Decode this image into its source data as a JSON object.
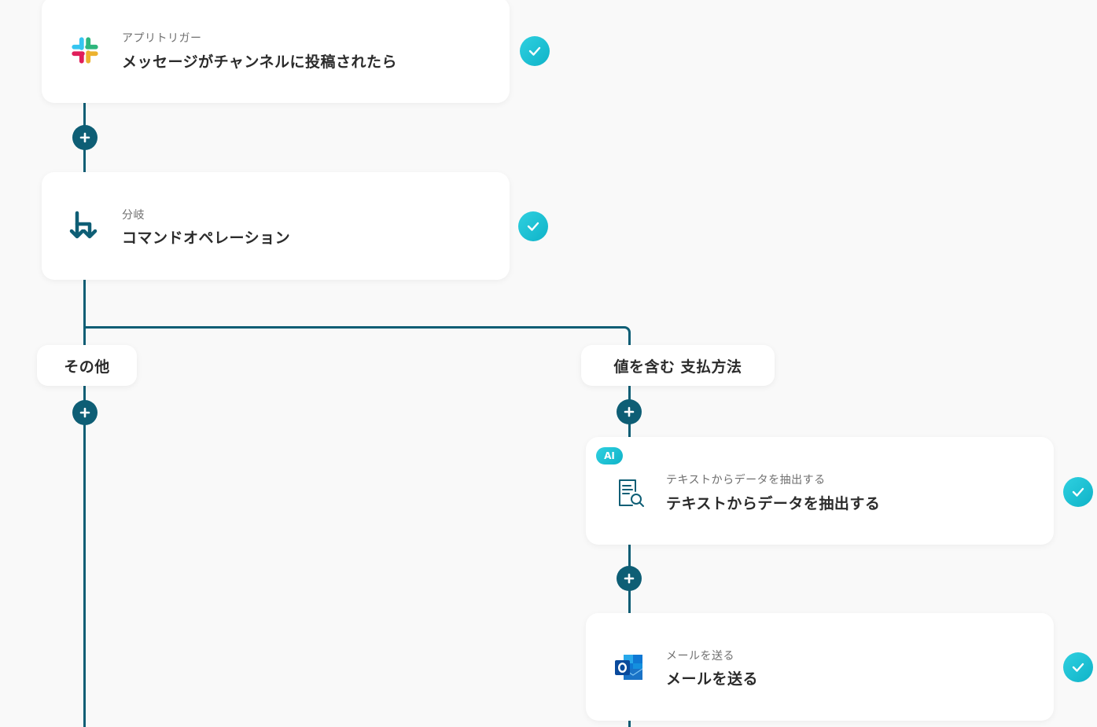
{
  "steps": [
    {
      "subtitle": "アプリトリガー",
      "title": "メッセージがチャンネルに投稿されたら",
      "icon": "slack-icon"
    },
    {
      "subtitle": "分岐",
      "title": "コマンドオペレーション",
      "icon": "branch-icon"
    },
    {
      "subtitle": "テキストからデータを抽出する",
      "title": "テキストからデータを抽出する",
      "icon": "document-search-icon",
      "badge": "AI"
    },
    {
      "subtitle": "メールを送る",
      "title": "メールを送る",
      "icon": "outlook-icon"
    }
  ],
  "branches": {
    "left_label": "その他",
    "right_label": "値を含む 支払方法"
  },
  "colors": {
    "line": "#0e5e75",
    "check": "#1ec3d6",
    "background": "#f9f9f9"
  }
}
